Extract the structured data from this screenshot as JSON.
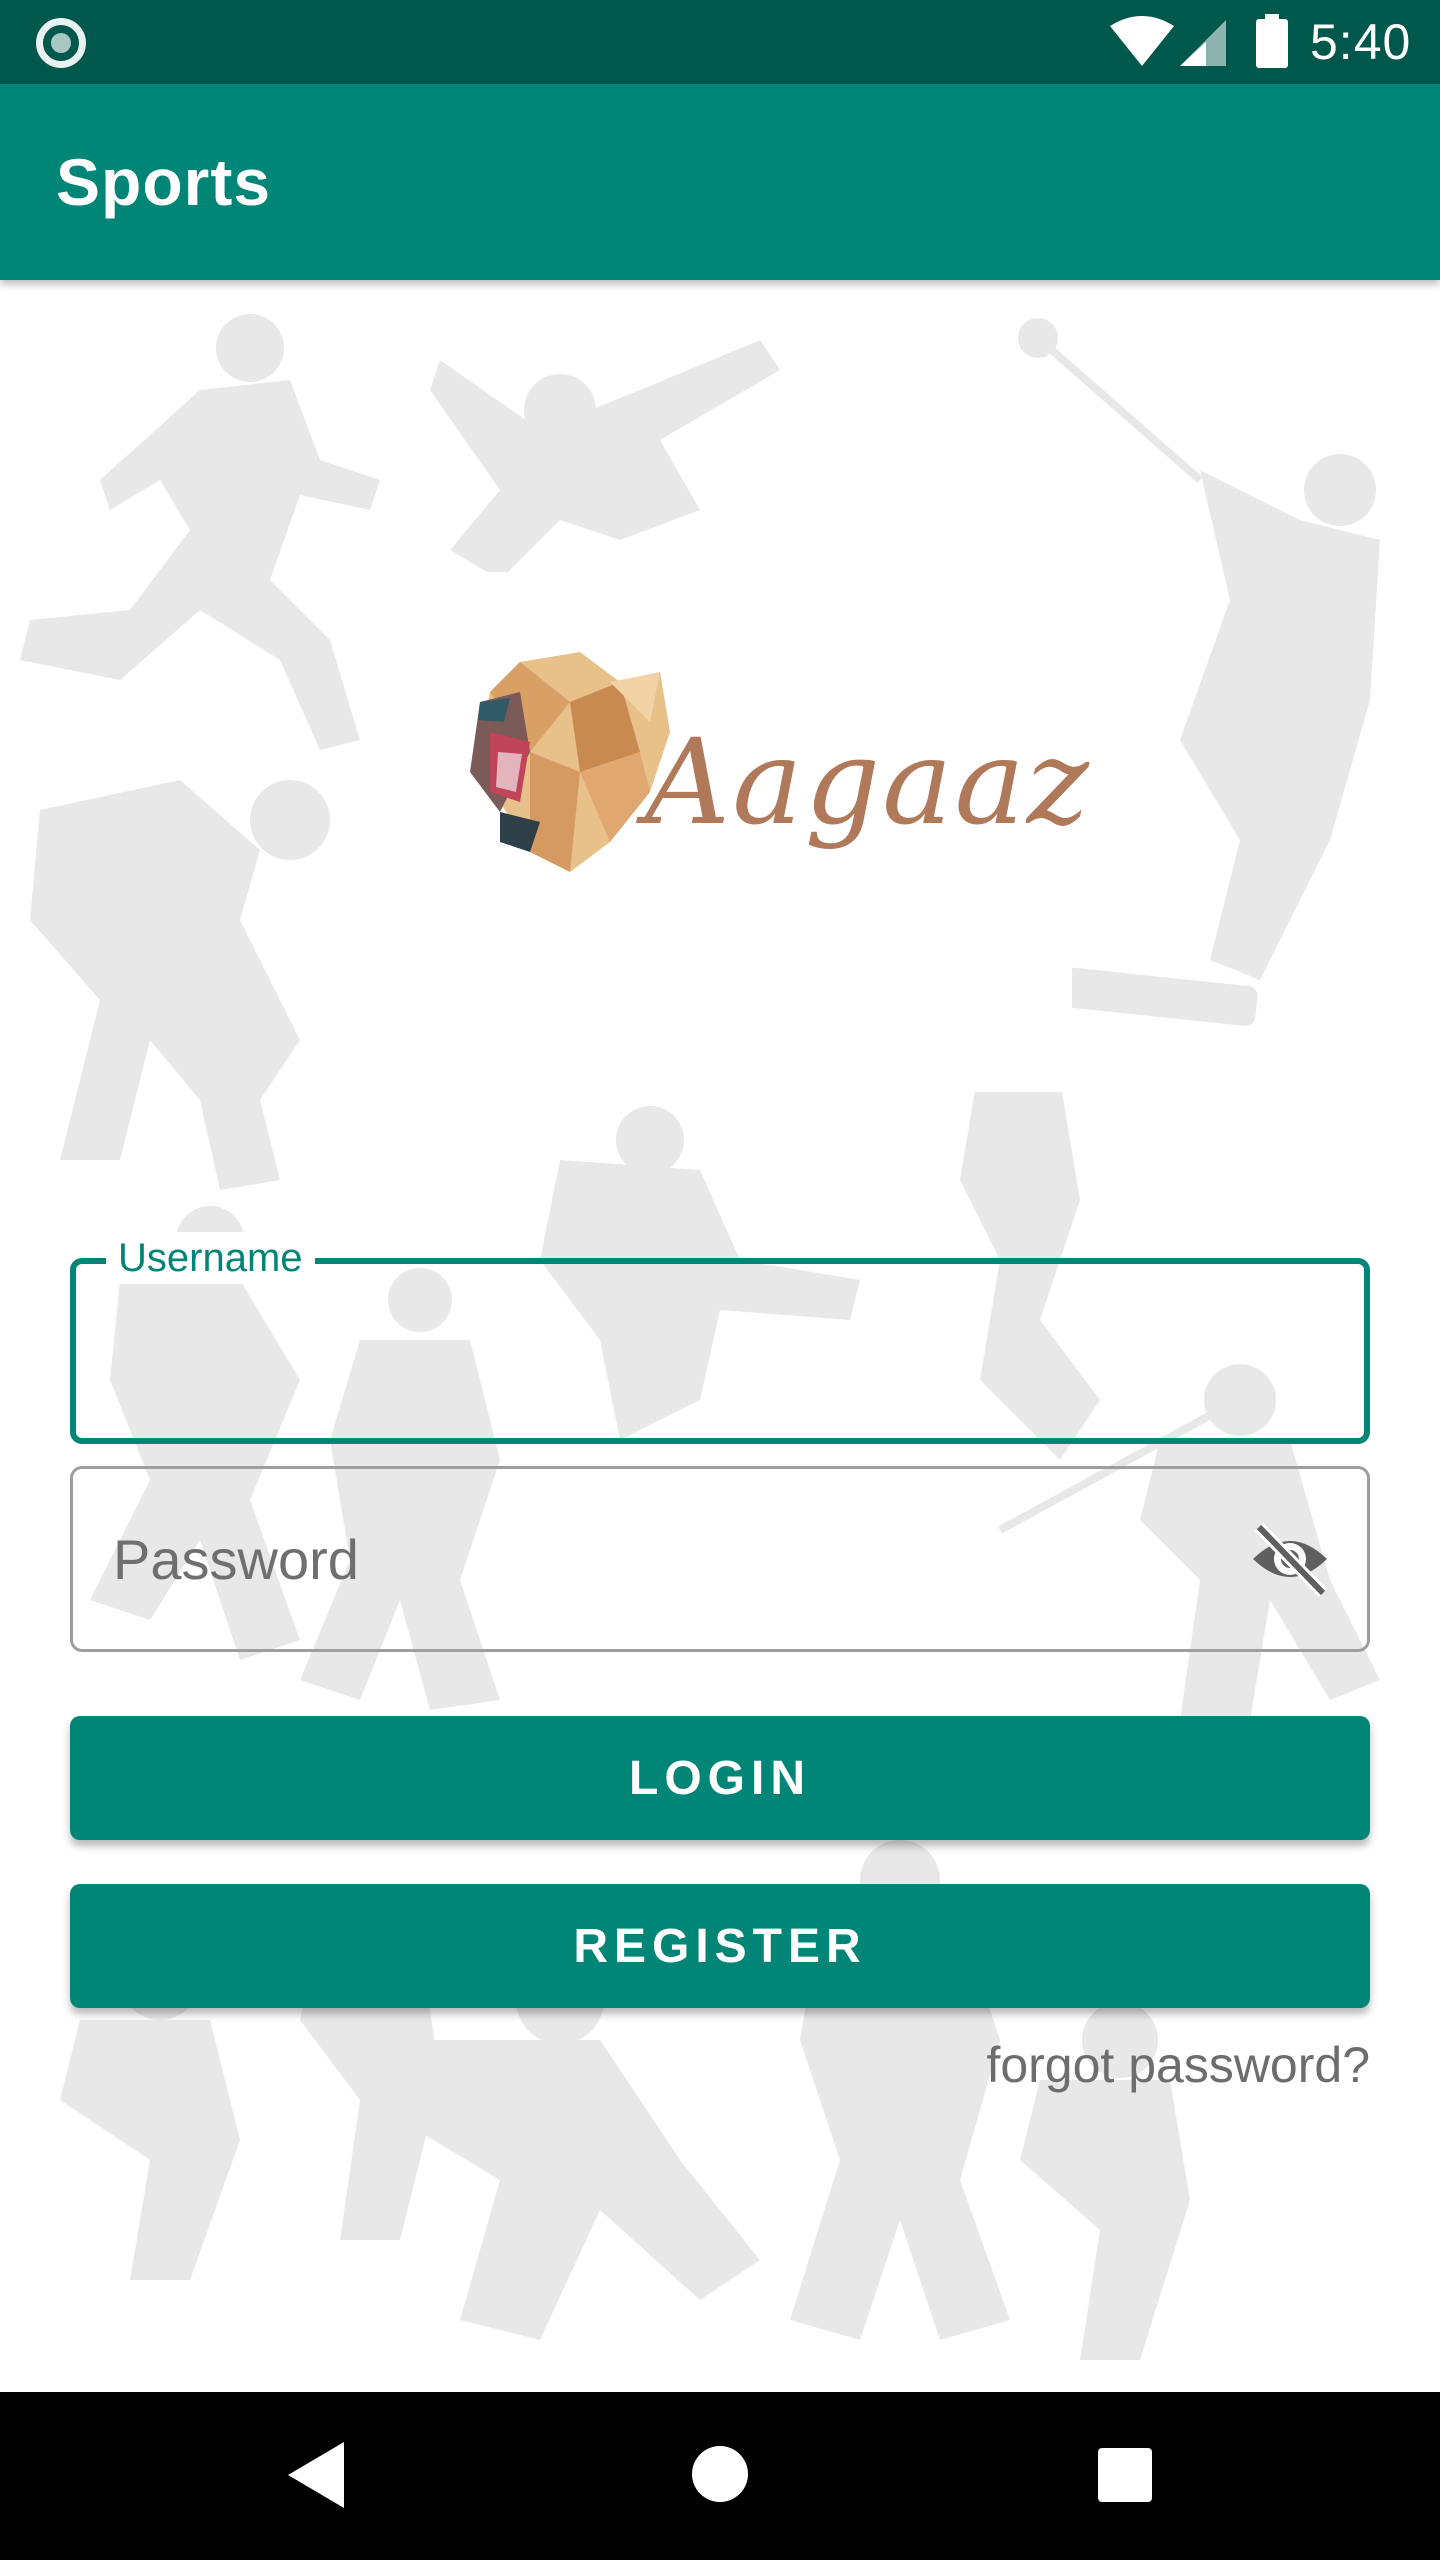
{
  "status_bar": {
    "time": "5:40",
    "left_icon": "circle-notification-icon",
    "icons": [
      "wifi-icon",
      "signal-icon",
      "battery-icon"
    ]
  },
  "app_bar": {
    "title": "Sports"
  },
  "logo": {
    "text": "Aagaaz",
    "icon": "lion-icon"
  },
  "login_form": {
    "username": {
      "label": "Username",
      "value": ""
    },
    "password": {
      "placeholder": "Password",
      "value": "",
      "toggle_icon": "eye-off-icon"
    },
    "login_label": "LOGIN",
    "register_label": "REGISTER",
    "forgot_label": "forgot password?"
  },
  "nav_bar": {
    "icons": [
      "back-icon",
      "home-icon",
      "recent-apps-icon"
    ]
  },
  "colors": {
    "primary": "#008577",
    "primary_dark": "#00574b",
    "text_hint": "#6f6f6f",
    "silhouette": "#e6e6e6"
  }
}
